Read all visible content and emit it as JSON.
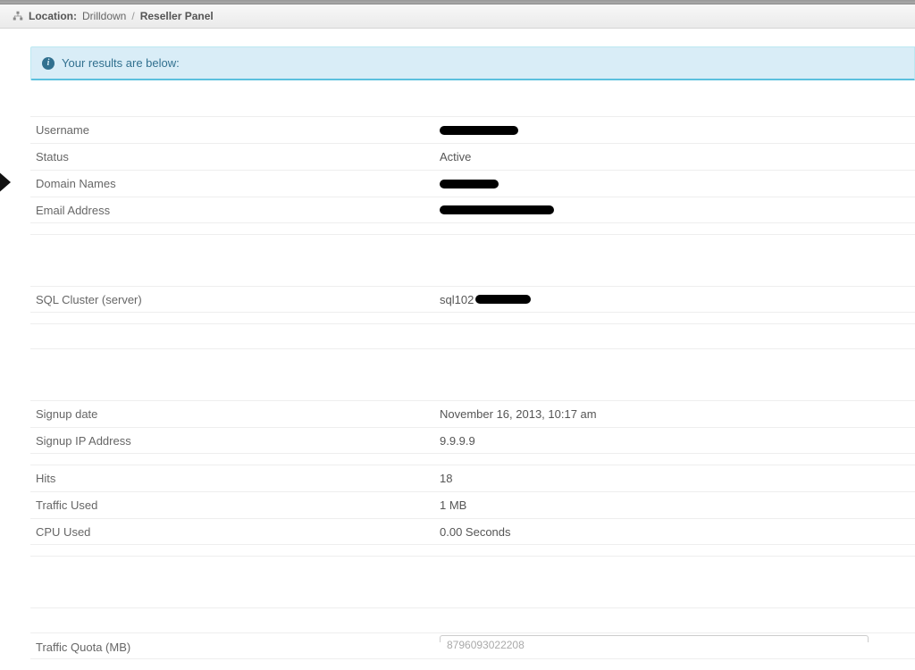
{
  "breadcrumb": {
    "label": "Location:",
    "item1": "Drilldown",
    "separator": "/",
    "current": "Reseller Panel"
  },
  "notice": {
    "text": "Your results are below:"
  },
  "sections": {
    "account": {
      "username_label": "Username",
      "status_label": "Status",
      "status_value": "Active",
      "domain_label": "Domain Names",
      "email_label": "Email Address"
    },
    "server": {
      "sql_label": "SQL Cluster (server)",
      "sql_prefix": "sql102"
    },
    "signup": {
      "date_label": "Signup date",
      "date_value": "November 16, 2013, 10:17 am",
      "ip_label": "Signup IP Address",
      "ip_value": "9.9.9.9"
    },
    "usage": {
      "hits_label": "Hits",
      "hits_value": "18",
      "traffic_label": "Traffic Used",
      "traffic_value": "1 MB",
      "cpu_label": "CPU Used",
      "cpu_value": "0.00 Seconds"
    },
    "quota": {
      "traffic_quota_label": "Traffic Quota (MB)",
      "traffic_quota_value": "8796093022208"
    }
  }
}
